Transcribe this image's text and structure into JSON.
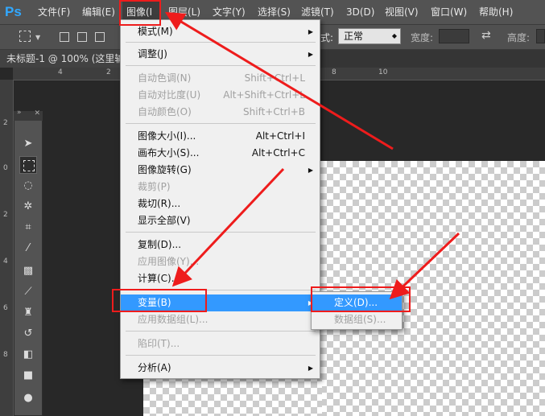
{
  "app": {
    "logo": "Ps"
  },
  "menubar": {
    "items": [
      "文件(F)",
      "编辑(E)",
      "图像(I",
      "图层(L)",
      "文字(Y)",
      "选择(S)",
      "滤镜(T)",
      "3D(D)",
      "视图(V)",
      "窗口(W)",
      "帮助(H)"
    ]
  },
  "options": {
    "style_label": "式:",
    "style_value": "正常",
    "width_label": "宽度:",
    "height_label": "高度:"
  },
  "document": {
    "tab_title": "未标题-1 @ 100% (这里输入"
  },
  "rulers": {
    "top": [
      "4",
      "2",
      "0",
      "2",
      "4",
      "6",
      "8",
      "10"
    ],
    "left": [
      "2",
      "0",
      "2",
      "4",
      "6",
      "8"
    ]
  },
  "image_menu": {
    "items": [
      {
        "label": "模式(M)",
        "shortcut": "",
        "submenu": true,
        "disabled": false
      },
      {
        "label": "调整(J)",
        "shortcut": "",
        "submenu": true,
        "disabled": false
      },
      {
        "label": "自动色调(N)",
        "shortcut": "Shift+Ctrl+L",
        "submenu": false,
        "disabled": true
      },
      {
        "label": "自动对比度(U)",
        "shortcut": "Alt+Shift+Ctrl+L",
        "submenu": false,
        "disabled": true
      },
      {
        "label": "自动颜色(O)",
        "shortcut": "Shift+Ctrl+B",
        "submenu": false,
        "disabled": true
      },
      {
        "label": "图像大小(I)...",
        "shortcut": "Alt+Ctrl+I",
        "submenu": false,
        "disabled": false
      },
      {
        "label": "画布大小(S)...",
        "shortcut": "Alt+Ctrl+C",
        "submenu": false,
        "disabled": false
      },
      {
        "label": "图像旋转(G)",
        "shortcut": "",
        "submenu": true,
        "disabled": false
      },
      {
        "label": "裁剪(P)",
        "shortcut": "",
        "submenu": false,
        "disabled": true
      },
      {
        "label": "裁切(R)...",
        "shortcut": "",
        "submenu": false,
        "disabled": false
      },
      {
        "label": "显示全部(V)",
        "shortcut": "",
        "submenu": false,
        "disabled": false
      },
      {
        "label": "复制(D)...",
        "shortcut": "",
        "submenu": false,
        "disabled": false
      },
      {
        "label": "应用图像(Y)...",
        "shortcut": "",
        "submenu": false,
        "disabled": true
      },
      {
        "label": "计算(C)...",
        "shortcut": "",
        "submenu": false,
        "disabled": false
      },
      {
        "label": "变量(B)",
        "shortcut": "",
        "submenu": true,
        "disabled": false,
        "highlighted": true
      },
      {
        "label": "应用数据组(L)...",
        "shortcut": "",
        "submenu": false,
        "disabled": true
      },
      {
        "label": "陷印(T)...",
        "shortcut": "",
        "submenu": false,
        "disabled": true
      },
      {
        "label": "分析(A)",
        "shortcut": "",
        "submenu": true,
        "disabled": false
      }
    ]
  },
  "variables_submenu": {
    "items": [
      {
        "label": "定义(D)...",
        "highlighted": true,
        "disabled": false
      },
      {
        "label": "数据组(S)...",
        "highlighted": false,
        "disabled": true
      }
    ]
  },
  "colors": {
    "highlight": "#3399ff",
    "annotation_red": "#ee1c1c",
    "menubar_bg": "#535353",
    "menu_bg": "#f0f0f0"
  }
}
